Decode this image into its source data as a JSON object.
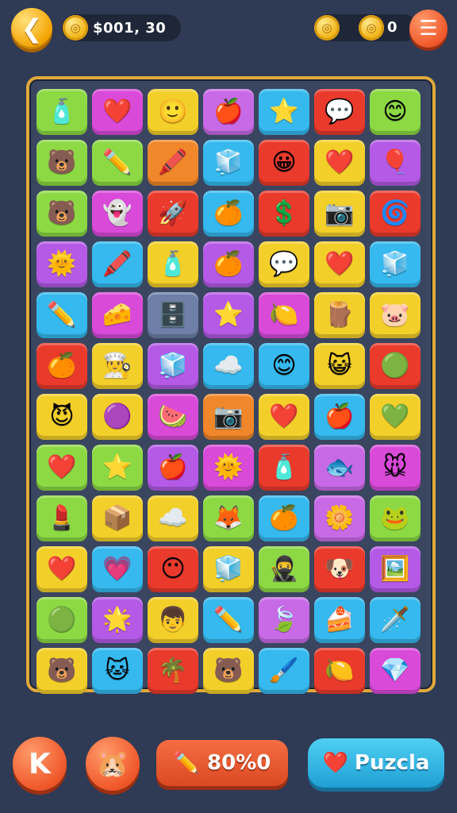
{
  "header": {
    "back_icon": "back-arrow-icon",
    "coin_value": "$001, 30",
    "right_coin_value": "0",
    "menu_icon": "hamburger-menu-icon"
  },
  "board": {
    "colors": {
      "frame": "#e0a93a",
      "background": "#3a4560"
    },
    "rows": [
      [
        {
          "icon": "bottle",
          "glyph": "🧴",
          "color": "#8cd944"
        },
        {
          "icon": "heart",
          "glyph": "❤️",
          "color": "#d94ad9"
        },
        {
          "icon": "smiley",
          "glyph": "🙂",
          "color": "#f3cf2a"
        },
        {
          "icon": "apple-ball",
          "glyph": "🍎",
          "color": "#c86ae6"
        },
        {
          "icon": "star",
          "glyph": "⭐",
          "color": "#35b9ee"
        },
        {
          "icon": "speech-bubble",
          "glyph": "💬",
          "color": "#ea3a2c"
        },
        {
          "icon": "smiley",
          "glyph": "😊",
          "color": "#8cd944"
        }
      ],
      [
        {
          "icon": "bear-face",
          "glyph": "🐻",
          "color": "#8cd944"
        },
        {
          "icon": "pencil",
          "glyph": "✏️",
          "color": "#8cd944"
        },
        {
          "icon": "crayon",
          "glyph": "🖍️",
          "color": "#f0872a"
        },
        {
          "icon": "block",
          "glyph": "🧊",
          "color": "#35b9ee"
        },
        {
          "icon": "face",
          "glyph": "😀",
          "color": "#ea3a2c"
        },
        {
          "icon": "heart",
          "glyph": "❤️",
          "color": "#f3cf2a"
        },
        {
          "icon": "balloon",
          "glyph": "🎈",
          "color": "#b45ae6"
        }
      ],
      [
        {
          "icon": "bear-face",
          "glyph": "🐻",
          "color": "#8cd944"
        },
        {
          "icon": "ghost-face",
          "glyph": "👻",
          "color": "#d94ad9"
        },
        {
          "icon": "rocket",
          "glyph": "🚀",
          "color": "#ea3a2c"
        },
        {
          "icon": "orange-face",
          "glyph": "🍊",
          "color": "#35b9ee"
        },
        {
          "icon": "dollar-coin",
          "glyph": "💲",
          "color": "#ea3a2c"
        },
        {
          "icon": "camera",
          "glyph": "📷",
          "color": "#f3cf2a"
        },
        {
          "icon": "swirl",
          "glyph": "🌀",
          "color": "#ea3a2c"
        }
      ],
      [
        {
          "icon": "sun-face",
          "glyph": "🌞",
          "color": "#b45ae6"
        },
        {
          "icon": "crayon",
          "glyph": "🖍️",
          "color": "#35b9ee"
        },
        {
          "icon": "bottle",
          "glyph": "🧴",
          "color": "#f3cf2a"
        },
        {
          "icon": "orange-face",
          "glyph": "🍊",
          "color": "#b45ae6"
        },
        {
          "icon": "speech-bubble",
          "glyph": "💬",
          "color": "#f3cf2a"
        },
        {
          "icon": "heart",
          "glyph": "❤️",
          "color": "#f3cf2a"
        },
        {
          "icon": "ice-cube",
          "glyph": "🧊",
          "color": "#35b9ee"
        }
      ],
      [
        {
          "icon": "pencil",
          "glyph": "✏️",
          "color": "#35b9ee"
        },
        {
          "icon": "cheese",
          "glyph": "🧀",
          "color": "#d94ad9"
        },
        {
          "icon": "safe-box",
          "glyph": "🗄️",
          "color": "#6e7fa8"
        },
        {
          "icon": "star",
          "glyph": "⭐",
          "color": "#b45ae6"
        },
        {
          "icon": "lemon",
          "glyph": "🍋",
          "color": "#d94ad9"
        },
        {
          "icon": "wood-stack",
          "glyph": "🪵",
          "color": "#f3cf2a"
        },
        {
          "icon": "pig-face",
          "glyph": "🐷",
          "color": "#f3cf2a"
        }
      ],
      [
        {
          "icon": "orange-face",
          "glyph": "🍊",
          "color": "#ea3a2c"
        },
        {
          "icon": "chef-face",
          "glyph": "👨‍🍳",
          "color": "#f3cf2a"
        },
        {
          "icon": "ice-cube",
          "glyph": "🧊",
          "color": "#b45ae6"
        },
        {
          "icon": "cloud",
          "glyph": "☁️",
          "color": "#35b9ee"
        },
        {
          "icon": "smiley",
          "glyph": "😊",
          "color": "#35b9ee"
        },
        {
          "icon": "pink-face",
          "glyph": "😺",
          "color": "#f3cf2a"
        },
        {
          "icon": "green-face",
          "glyph": "🟢",
          "color": "#ea3a2c"
        }
      ],
      [
        {
          "icon": "purple-face",
          "glyph": "😈",
          "color": "#f3cf2a"
        },
        {
          "icon": "purple-face",
          "glyph": "🟣",
          "color": "#f3cf2a"
        },
        {
          "icon": "melon-bowl",
          "glyph": "🍉",
          "color": "#d94ad9"
        },
        {
          "icon": "camera",
          "glyph": "📷",
          "color": "#f0872a"
        },
        {
          "icon": "heart",
          "glyph": "❤️",
          "color": "#f3cf2a"
        },
        {
          "icon": "apple",
          "glyph": "🍎",
          "color": "#35b9ee"
        },
        {
          "icon": "green-gem",
          "glyph": "💚",
          "color": "#f3cf2a"
        }
      ],
      [
        {
          "icon": "heart",
          "glyph": "❤️",
          "color": "#8cd944"
        },
        {
          "icon": "star",
          "glyph": "⭐",
          "color": "#8cd944"
        },
        {
          "icon": "apple",
          "glyph": "🍎",
          "color": "#b45ae6"
        },
        {
          "icon": "sun-face",
          "glyph": "🌞",
          "color": "#d94ad9"
        },
        {
          "icon": "bottle",
          "glyph": "🧴",
          "color": "#ea3a2c"
        },
        {
          "icon": "fish-face",
          "glyph": "🐟",
          "color": "#c86ae6"
        },
        {
          "icon": "mouse-face",
          "glyph": "🐭",
          "color": "#d94ad9"
        }
      ],
      [
        {
          "icon": "lipstick",
          "glyph": "💄",
          "color": "#8cd944"
        },
        {
          "icon": "box",
          "glyph": "📦",
          "color": "#f3cf2a"
        },
        {
          "icon": "cloud-face",
          "glyph": "☁️",
          "color": "#f3cf2a"
        },
        {
          "icon": "fox-face",
          "glyph": "🦊",
          "color": "#8cd944"
        },
        {
          "icon": "orange-face",
          "glyph": "🍊",
          "color": "#35b9ee"
        },
        {
          "icon": "flower-face",
          "glyph": "🌼",
          "color": "#c86ae6"
        },
        {
          "icon": "frog-face",
          "glyph": "🐸",
          "color": "#8cd944"
        }
      ],
      [
        {
          "icon": "heart",
          "glyph": "❤️",
          "color": "#f3cf2a"
        },
        {
          "icon": "pink-heart",
          "glyph": "💗",
          "color": "#35b9ee"
        },
        {
          "icon": "blue-face",
          "glyph": "😶",
          "color": "#ea3a2c"
        },
        {
          "icon": "ice-cube",
          "glyph": "🧊",
          "color": "#f3cf2a"
        },
        {
          "icon": "ninja-face",
          "glyph": "🥷",
          "color": "#8cd944"
        },
        {
          "icon": "dog-face",
          "glyph": "🐶",
          "color": "#ea3a2c"
        },
        {
          "icon": "paint-frame",
          "glyph": "🖼️",
          "color": "#b45ae6"
        }
      ],
      [
        {
          "icon": "green-face",
          "glyph": "🟢",
          "color": "#8cd944"
        },
        {
          "icon": "paper-star",
          "glyph": "🌟",
          "color": "#b45ae6"
        },
        {
          "icon": "boy-face",
          "glyph": "👦",
          "color": "#f3cf2a"
        },
        {
          "icon": "pencil",
          "glyph": "✏️",
          "color": "#35b9ee"
        },
        {
          "icon": "leaf-face",
          "glyph": "🍃",
          "color": "#c86ae6"
        },
        {
          "icon": "cake",
          "glyph": "🍰",
          "color": "#35b9ee"
        },
        {
          "icon": "sword",
          "glyph": "🗡️",
          "color": "#35b9ee"
        }
      ],
      [
        {
          "icon": "bear-face",
          "glyph": "🐻",
          "color": "#f3cf2a"
        },
        {
          "icon": "cat-face",
          "glyph": "🐱",
          "color": "#35b9ee"
        },
        {
          "icon": "palm-tree",
          "glyph": "🌴",
          "color": "#ea3a2c"
        },
        {
          "icon": "bear-face",
          "glyph": "🐻",
          "color": "#f3cf2a"
        },
        {
          "icon": "brush",
          "glyph": "🖌️",
          "color": "#35b9ee"
        },
        {
          "icon": "lemon-face",
          "glyph": "🍋",
          "color": "#ea3a2c"
        },
        {
          "icon": "crystal",
          "glyph": "💎",
          "color": "#d94ad9"
        }
      ]
    ]
  },
  "footer": {
    "k_icon": "cursor-k-icon",
    "pet_icon": "hamster-face-icon",
    "score_icon": "pencil-icon",
    "score_label": "80%0",
    "puzzle_icon": "heart-icon",
    "puzzle_label": "Puzcla"
  }
}
